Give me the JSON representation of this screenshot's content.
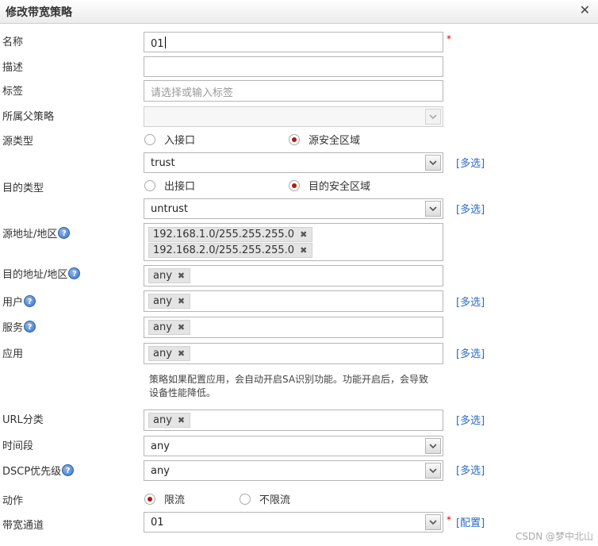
{
  "dialog": {
    "title": "修改带宽策略",
    "close_symbol": "✕"
  },
  "fields": {
    "name": {
      "label": "名称",
      "value": "01"
    },
    "description": {
      "label": "描述",
      "value": ""
    },
    "tags": {
      "label": "标签",
      "placeholder": "请选择或输入标签"
    },
    "parent_policy": {
      "label": "所属父策略",
      "value": ""
    },
    "source_type": {
      "label": "源类型",
      "options": [
        "入接口",
        "源安全区域"
      ],
      "selected": "源安全区域",
      "zone_value": "trust"
    },
    "dest_type": {
      "label": "目的类型",
      "options": [
        "出接口",
        "目的安全区域"
      ],
      "selected": "目的安全区域",
      "zone_value": "untrust"
    },
    "source_address": {
      "label": "源地址/地区",
      "tags": [
        "192.168.1.0/255.255.255.0",
        "192.168.2.0/255.255.255.0"
      ]
    },
    "dest_address": {
      "label": "目的地址/地区",
      "tags": [
        "any"
      ]
    },
    "user": {
      "label": "用户",
      "tags": [
        "any"
      ]
    },
    "service": {
      "label": "服务",
      "tags": [
        "any"
      ]
    },
    "application": {
      "label": "应用",
      "tags": [
        "any"
      ],
      "note": "策略如果配置应用，会自动开启SA识别功能。功能开启后，会导致设备性能降低。"
    },
    "url_category": {
      "label": "URL分类",
      "tags": [
        "any"
      ]
    },
    "time_range": {
      "label": "时间段",
      "value": "any"
    },
    "dscp_priority": {
      "label": "DSCP优先级",
      "value": "any"
    },
    "action": {
      "label": "动作",
      "options": [
        "限流",
        "不限流"
      ],
      "selected": "限流"
    },
    "bandwidth_channel": {
      "label": "带宽通道",
      "value": "01"
    }
  },
  "links": {
    "multi_select": "[多选]",
    "configure": "[配置]"
  },
  "help_symbol": "?",
  "tag_remove_symbol": "✖",
  "required_mark": "*",
  "watermark": "CSDN @梦中北山",
  "colors": {
    "accent_link": "#2a6cc4",
    "radio_selected": "#b01818",
    "required": "#d40000"
  }
}
